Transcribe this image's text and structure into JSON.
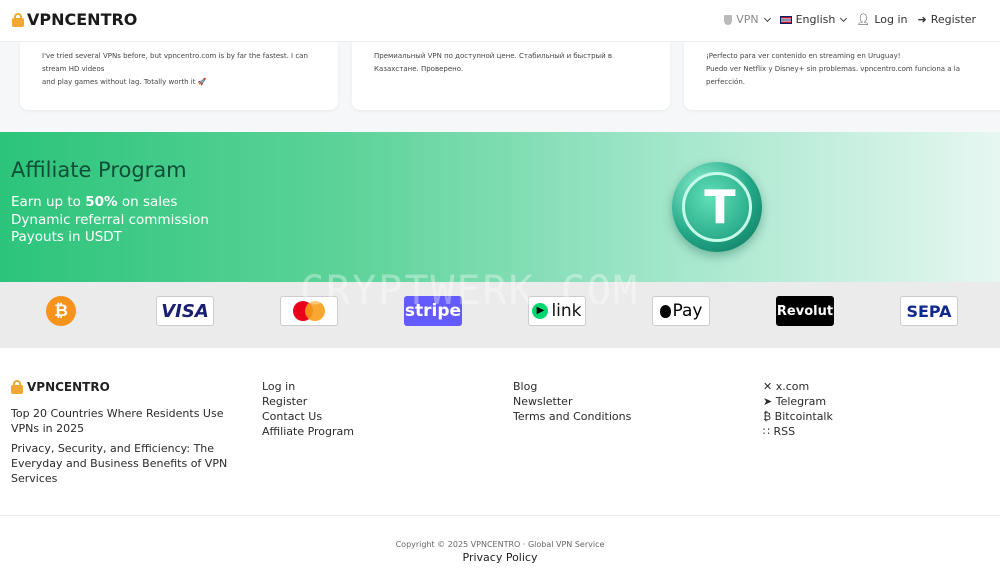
{
  "nav": {
    "brand": "VPNCENTRO",
    "vpn": "VPN",
    "language": "English",
    "login": "Log in",
    "register": "Register"
  },
  "reviews": [
    {
      "text1": "I've tried several VPNs before, but vpncentro.com is by far the fastest. I can stream HD videos",
      "text2": "and play games without lag. Totally worth it 🚀"
    },
    {
      "text1": "Премиальный VPN по доступной цене. Стабильный и быстрый в Казахстане. Проверено.",
      "text2": ""
    },
    {
      "text1": "¡Perfecto para ver contenido en streaming en Uruguay!",
      "text2": "Puedo ver Netflix y Disney+ sin problemas. vpncentro.com funciona a la perfección."
    }
  ],
  "affiliate": {
    "title": "Affiliate Program",
    "line1_pre": "Earn up to ",
    "line1_bold": "50%",
    "line1_post": " on sales",
    "line2": "Dynamic referral commission",
    "line3": "Payouts in USDT"
  },
  "watermark": "CRYPTWERK.COM",
  "payments": {
    "visa": "VISA",
    "stripe": "stripe",
    "link": "link",
    "applepay": "Pay",
    "revolut": "Revolut",
    "sepa": "SEPA"
  },
  "footer": {
    "brand": "VPNCENTRO",
    "articles": [
      "Top 20 Countries Where Residents Use VPNs in 2025",
      "Privacy, Security, and Efficiency: The Everyday and Business Benefits of VPN Services"
    ],
    "col2": [
      "Log in",
      "Register",
      "Contact Us",
      "Affiliate Program"
    ],
    "col3": [
      "Blog",
      "Newsletter",
      "Terms and Conditions"
    ],
    "social": [
      "x.com",
      "Telegram",
      "Bitcointalk",
      "RSS"
    ]
  },
  "copyright": "Copyright © 2025 VPNCENTRO · Global VPN Service",
  "privacy": "Privacy Policy"
}
